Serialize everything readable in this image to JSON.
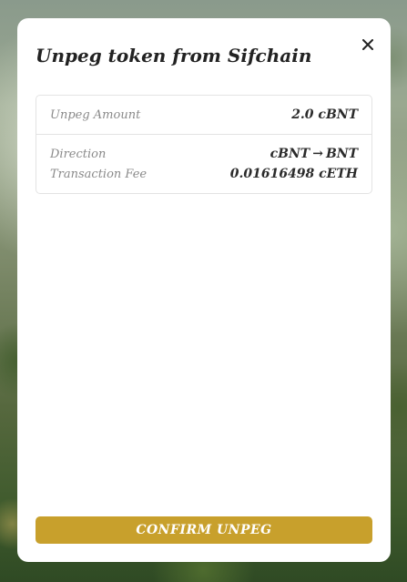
{
  "modal": {
    "title": "Unpeg token from Sifchain",
    "close_icon": "close-icon"
  },
  "details": {
    "unpeg_amount_label": "Unpeg Amount",
    "unpeg_amount_value": "2.0 cBNT",
    "direction_label": "Direction",
    "direction_from": "cBNT",
    "direction_arrow": "→",
    "direction_to": "BNT",
    "fee_label": "Transaction Fee",
    "fee_value": "0.01616498 cETH"
  },
  "actions": {
    "confirm_label": "CONFIRM UNPEG"
  },
  "colors": {
    "accent": "#c8a02c",
    "modal_bg": "#ffffff",
    "border": "#e3e3e3",
    "label_text": "#8a8a8a",
    "value_text": "#2b2b2b"
  }
}
